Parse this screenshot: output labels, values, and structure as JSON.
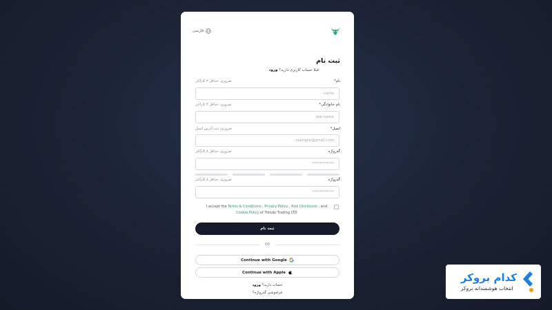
{
  "header": {
    "language_label": "فارسی",
    "icons": {
      "language": "globe-icon",
      "logo": "bull-logo"
    },
    "brand_color": "#2aa87a"
  },
  "form": {
    "title": "ثبت نام",
    "subtitle_text": "قبلا حساب کاربری دارید؟",
    "subtitle_link": "ورود",
    "fields": [
      {
        "label": "نام*",
        "hint": "ضروری، حداقل ۳ کاراکتر",
        "placeholder": "name"
      },
      {
        "label": "نام خانوادگی*",
        "hint": "ضروری، حداقل ۳ کاراکتر",
        "placeholder": "last name"
      },
      {
        "label": "ایمیل*",
        "hint": "ضروری، ثبت آدرس ایمیل",
        "placeholder": "example@gmail.com"
      },
      {
        "label": "گذرواژه",
        "hint": "ضروری، حداقل ۸ کاراکتر",
        "placeholder": "************"
      },
      {
        "label": "گذرواژه",
        "hint": "ضروری، حداقل ۸ کاراکتر",
        "placeholder": "************"
      }
    ],
    "password_strength_segments": 4,
    "terms": {
      "prefix": "I accept the ",
      "link1": "Terms & Conditions",
      "sep1": " , ",
      "link2": "Privacy Policy",
      "sep2": " , ",
      "link3": "Risk Disclosure",
      "sep3": " , and ",
      "link4": "Cookie Policy",
      "suffix": " of Trendo Trading LTD"
    },
    "submit_label": "ثبت نام",
    "divider_label": "OR",
    "google_label": "Continue with Google",
    "apple_label": "Continue with Apple",
    "footer_account_text": "حساب دارید؟",
    "footer_account_link": "ورود",
    "forgot_password": "فراموشی گذرواژه؟"
  },
  "watermark": {
    "name": "کدام بروکر",
    "tagline": "انتخاب هوشمندانه بروکر",
    "accent": "#1e7fe0",
    "dot_color": "#f39c12"
  }
}
